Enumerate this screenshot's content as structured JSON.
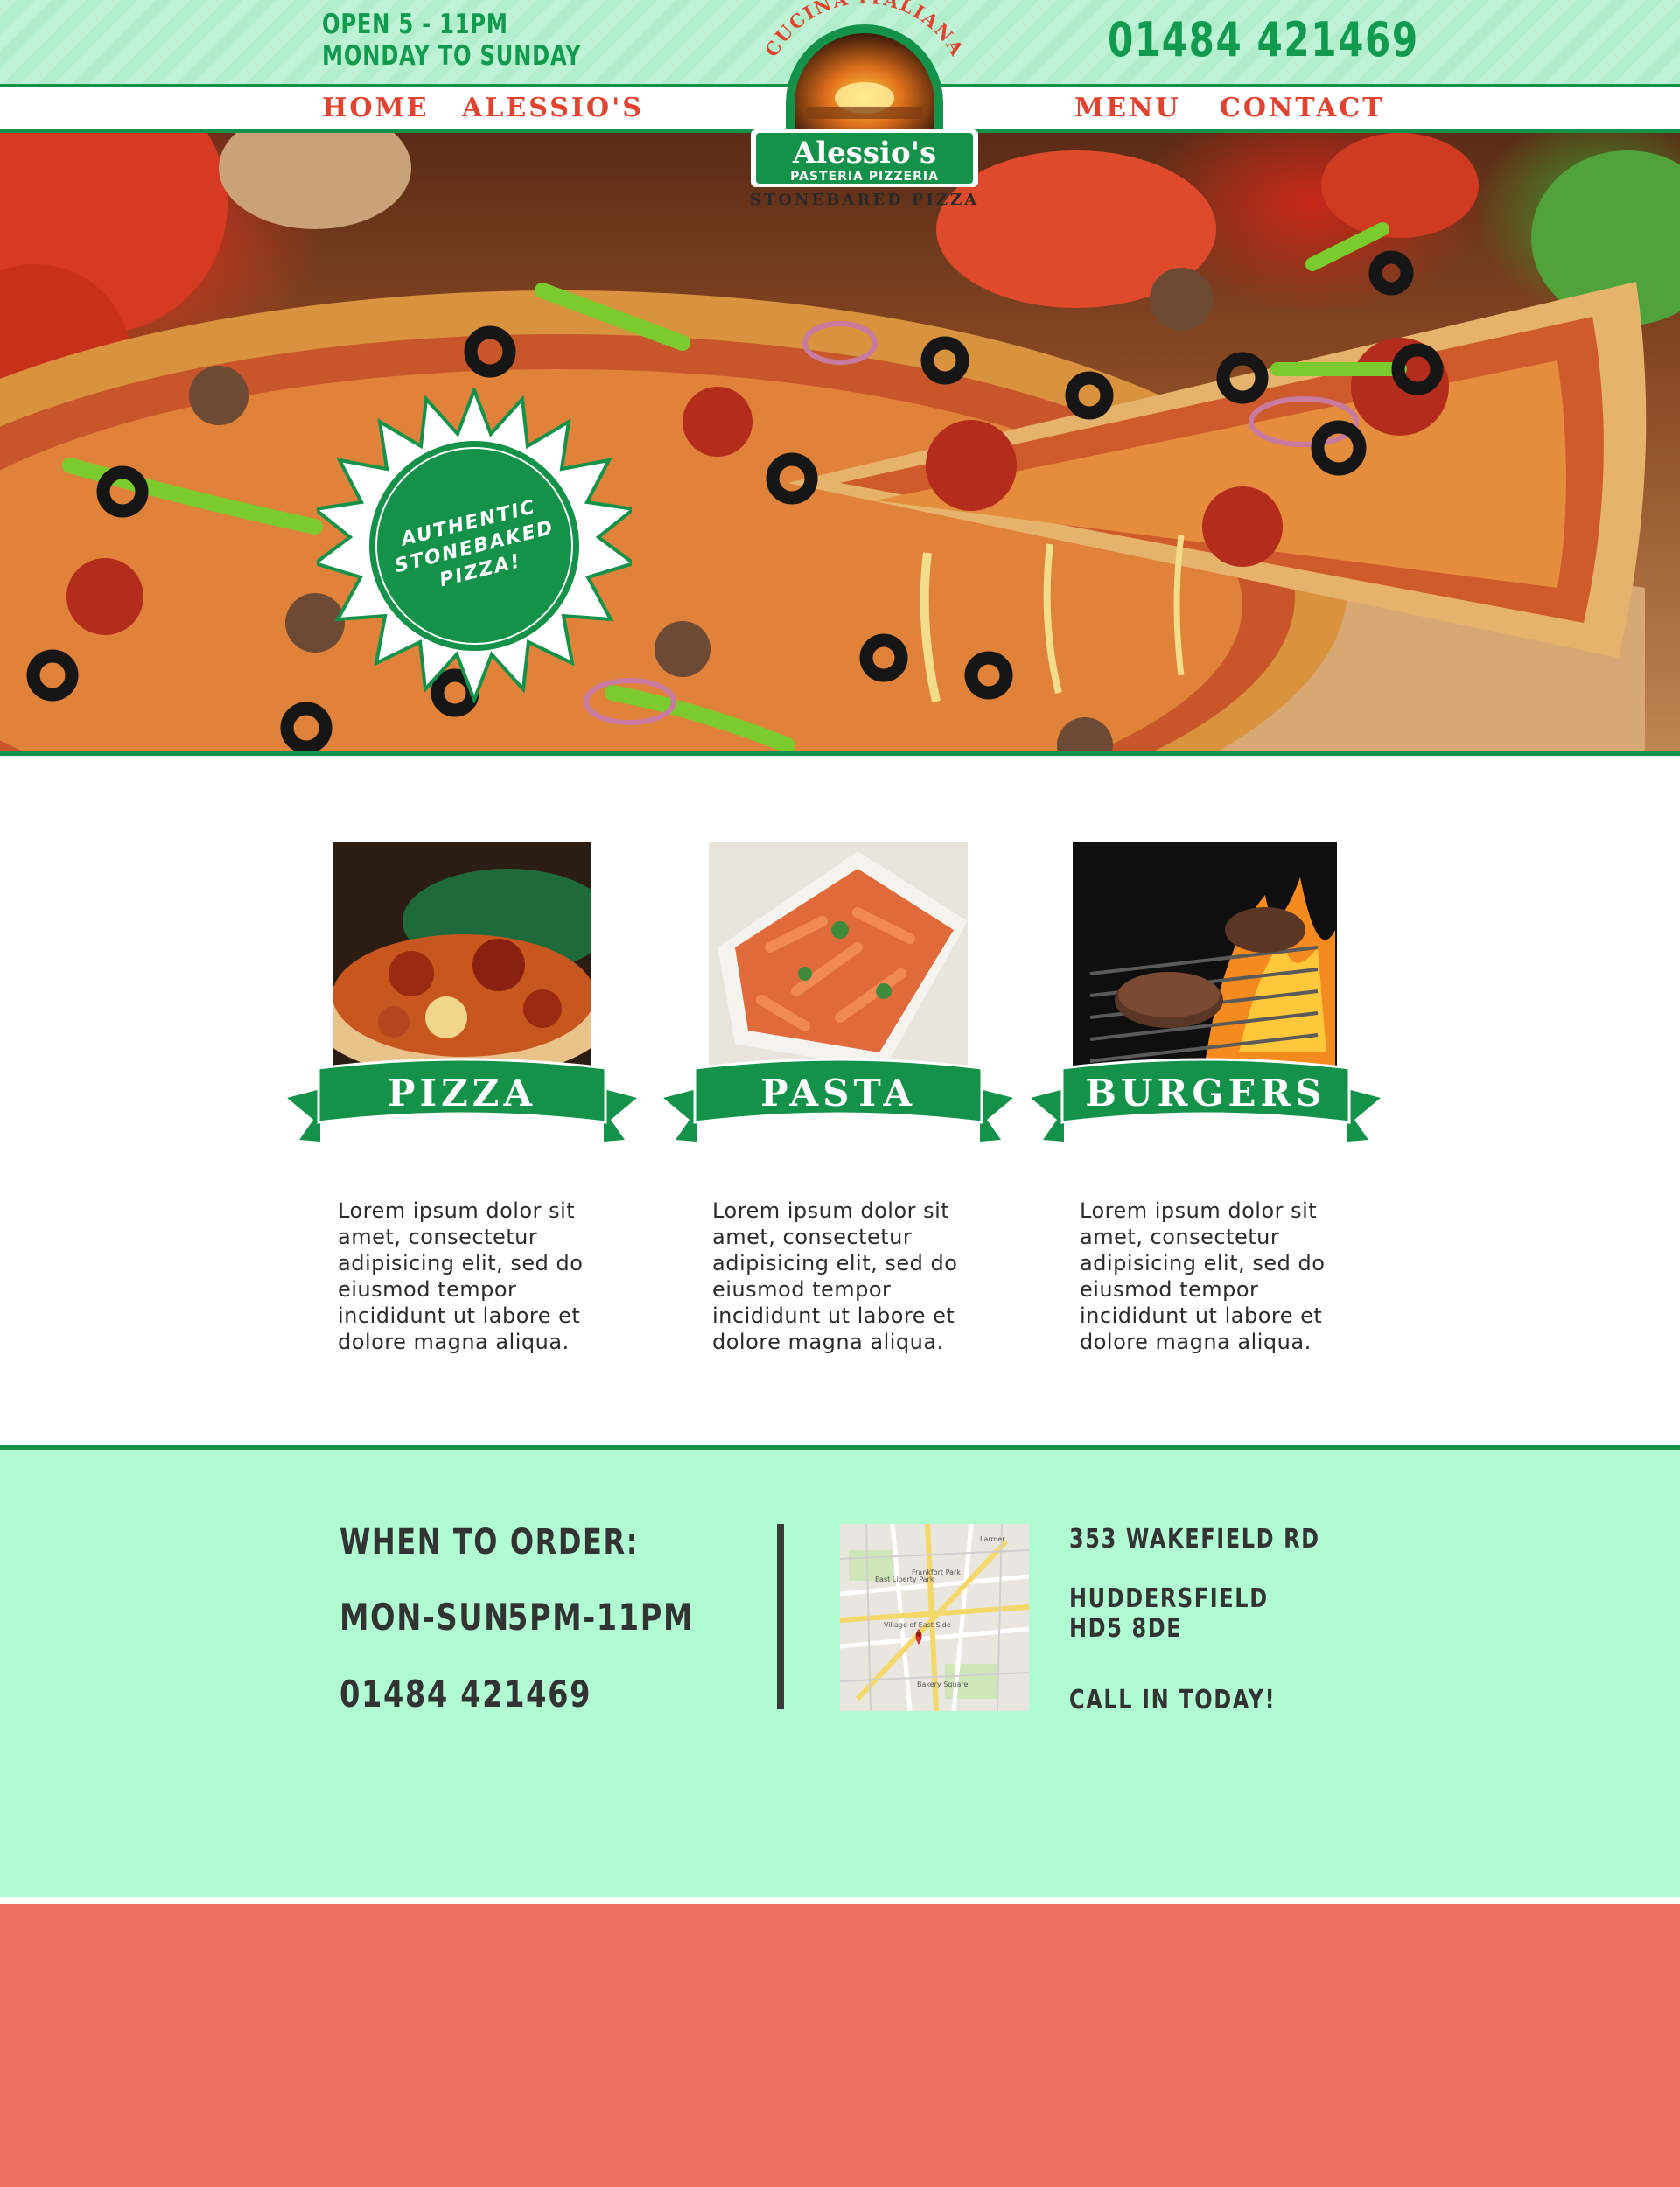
{
  "header": {
    "hours_line1": "OPEN 5 - 11PM",
    "hours_line2": "MONDAY TO SUNDAY",
    "phone": "01484 421469"
  },
  "nav": {
    "home": "HOME",
    "alessios": "ALESSIO'S",
    "menu": "MENU",
    "contact": "CONTACT"
  },
  "logo": {
    "arc_text": "CUCINA ITALIANA",
    "name": "Alessio's",
    "subtitle": "PASTERIA PIZZERIA",
    "tagline": "STONEBARED PIZZA"
  },
  "hero": {
    "badge_line1": "AUTHENTIC",
    "badge_line2": "STONEBAKED",
    "badge_line3": "PIZZA!"
  },
  "categories": [
    {
      "title": "PIZZA",
      "description": "Lorem ipsum dolor sit amet, consectetur adipisicing elit, sed do eiusmod tempor incididunt ut labore et dolore magna aliqua."
    },
    {
      "title": "PASTA",
      "description": "Lorem ipsum dolor sit amet, consectetur adipisicing elit, sed do eiusmod tempor incididunt ut labore et dolore magna aliqua."
    },
    {
      "title": "BURGERS",
      "description": "Lorem ipsum dolor sit amet, consectetur adipisicing elit, sed do eiusmod tempor incididunt ut labore et dolore magna aliqua."
    }
  ],
  "info": {
    "when_heading": "WHEN TO ORDER:",
    "days": "MON-SUN",
    "times": "5PM-11PM",
    "phone": "01484 421469",
    "address_line1": "353 WAKEFIELD RD",
    "address_line2": "HUDDERSFIELD",
    "address_line3": "HD5 8DE",
    "call_text": "CALL IN TODAY!",
    "map_labels": [
      "Larmer",
      "Frankfort Park",
      "East Liberty Park",
      "Village of East Side",
      "Bakery Square"
    ]
  },
  "colors": {
    "brand_green": "#14924a",
    "accent_red": "#e0432f",
    "mint": "#b0fbd2",
    "coral": "#f07060"
  }
}
